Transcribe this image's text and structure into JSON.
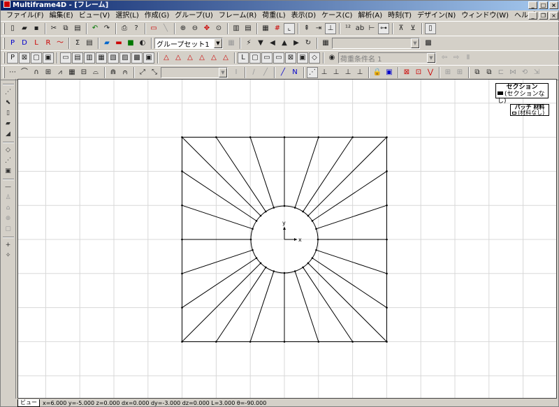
{
  "window": {
    "title": "Multiframe4D - [フレーム]"
  },
  "menu": [
    "ファイル(F)",
    "編集(E)",
    "ビュー(V)",
    "選択(L)",
    "作成(G)",
    "グループ(U)",
    "フレーム(R)",
    "荷重(L)",
    "表示(D)",
    "ケース(C)",
    "解析(A)",
    "時刻(T)",
    "デザイン(N)",
    "ウィンドウ(W)",
    "ヘルプ(H)"
  ],
  "toolbar2": {
    "group_set": "グループセット1"
  },
  "toolbar3": {
    "load_case": "荷重条件名 1"
  },
  "legend": {
    "section_title": "セクション",
    "section_item": "(セクションなし)",
    "patch_title": "パッチ 材料",
    "patch_item": "(材料なし)"
  },
  "axes": {
    "x_label": "x",
    "y_label": "y"
  },
  "status": {
    "tab": "ビュー",
    "coords": "x=6.000  y=-5.000  z=0.000  dx=0.000  dy=-3.000  dz=0.000  L=3.000  θ=-90.000"
  },
  "colors": {
    "titlebar_start": "#0a246a",
    "titlebar_end": "#a6caf0",
    "grid": "#d8d8d8",
    "frame": "#000000",
    "background": "#d4d0c8"
  }
}
